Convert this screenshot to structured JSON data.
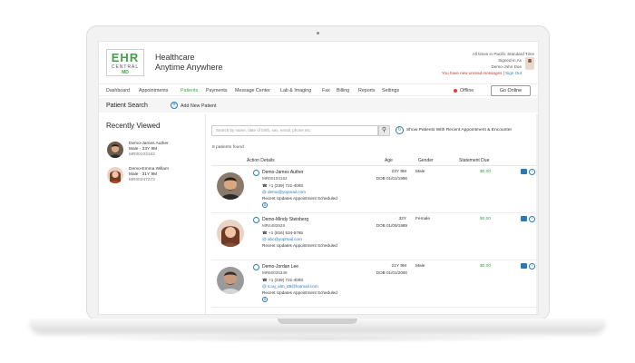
{
  "brand": {
    "logo_main": "EHR",
    "logo_sub": "CENTRAL",
    "logo_md": "MD",
    "tagline_1": "Healthcare",
    "tagline_2": "Anytime Anywhere"
  },
  "header": {
    "timezone": "All times in Pacific Standard Time",
    "signed_in_as": "Signed-in As",
    "user": "Demo-John Doe",
    "unread_message": "You have new unread messages",
    "sign_out": "Sign Out"
  },
  "nav": {
    "items": [
      "Dashboard",
      "Appointments",
      "Patients",
      "Payments",
      "Message Center",
      "Lab & Imaging",
      "Fax",
      "Billing",
      "Reports",
      "Settings"
    ],
    "status": "Offline",
    "go_online": "Go Online"
  },
  "titlebar": {
    "title": "Patient Search",
    "add_new": "Add New Patient"
  },
  "recently_viewed": {
    "title": "Recently Viewed",
    "patients": [
      {
        "name": "Demo-James Auther",
        "meta": "Male · 23Y 9M",
        "mrn": "MR00103162"
      },
      {
        "name": "Demo-Emma Willam",
        "meta": "Male · 31Y 9M",
        "mrn": "MR00347273"
      }
    ]
  },
  "search": {
    "placeholder": "Search by name, date of birth, sex, email, phone etc.",
    "show_recent": "Show Patients With Recent Appointment & Encounter",
    "found": "8 patients found"
  },
  "table": {
    "columns": [
      "Action Details",
      "Age",
      "Gender",
      "Statement Due"
    ],
    "rows": [
      {
        "name": "Demo-James Auther",
        "mrn": "MR00103162",
        "phone": "+1 (239) 721-4093",
        "email": "demo@yopmail.com",
        "updates_label": "Recent Updates",
        "updates": "Appointment Scheduled",
        "age": "23Y 9M",
        "dob_label": "DOB",
        "dob": "01/01/1996",
        "gender": "Male",
        "due": "$0.00"
      },
      {
        "name": "Demo-Mindy Steinberg",
        "mrn": "MR4483928",
        "phone": "+1 (816) 534-5765",
        "email": "abc@yopmail.com",
        "updates_label": "Recent Updates",
        "updates": "Appointment Scheduled",
        "age": "32Y",
        "dob_label": "DOB",
        "dob": "01/09/1989",
        "gender": "Female",
        "due": "$0.00"
      },
      {
        "name": "Demo-Jordan Lee",
        "mrn": "MR60035346",
        "phone": "+1 (239) 721-4093",
        "email": "s.raj_alm_88@hotmail.com",
        "updates_label": "Recent Updates",
        "updates": "Appointment Scheduled",
        "age": "21Y 9M",
        "dob_label": "DOB",
        "dob": "01/01/2000",
        "gender": "Male",
        "due": "$0.00"
      }
    ]
  },
  "colors": {
    "brand_green": "#3aa543",
    "accent_blue": "#2a7ab8",
    "offline_red": "#e53935"
  }
}
